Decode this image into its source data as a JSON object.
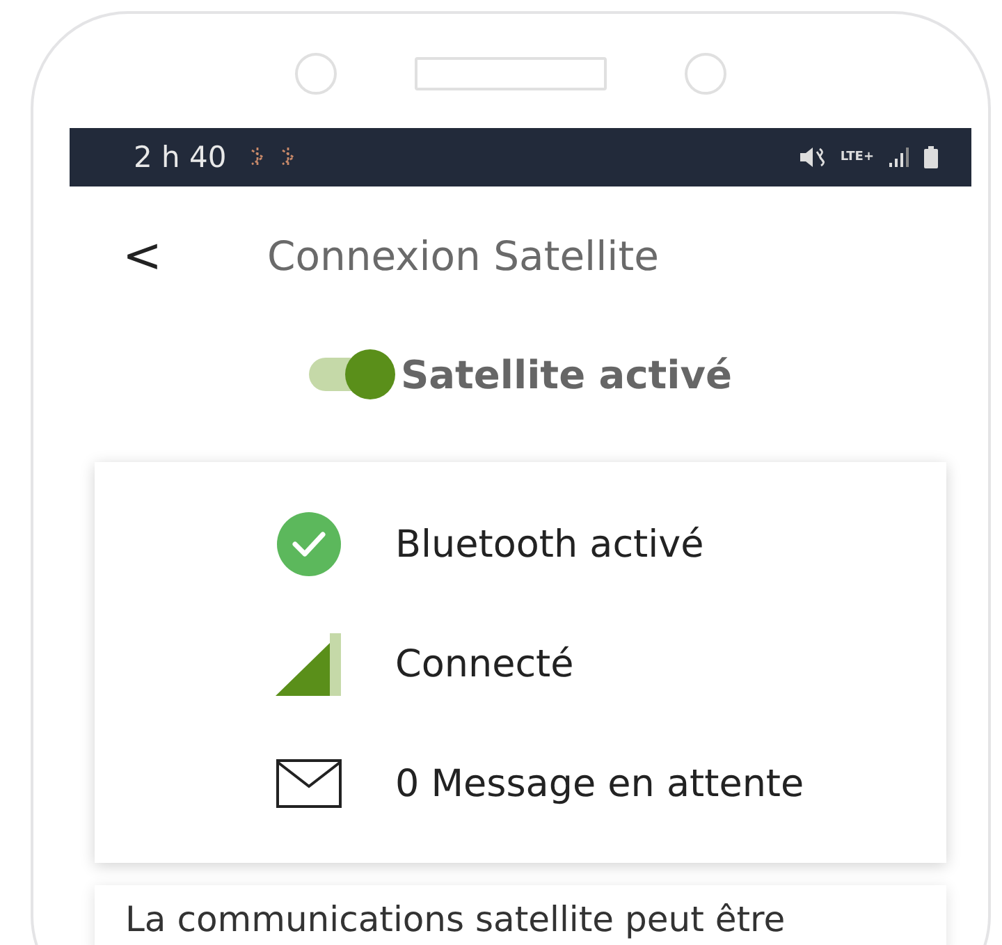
{
  "status_bar": {
    "time": "2 h 40",
    "network": "LTE+"
  },
  "header": {
    "back": "<",
    "title": "Connexion Satellite"
  },
  "satellite_toggle": {
    "label": "Satellite activé",
    "on": true
  },
  "status_items": [
    {
      "kind": "check",
      "label": "Bluetooth activé"
    },
    {
      "kind": "signal",
      "label": "Connecté"
    },
    {
      "kind": "mail",
      "label": "0 Message en attente"
    }
  ],
  "notice": "La communications satellite peut être"
}
